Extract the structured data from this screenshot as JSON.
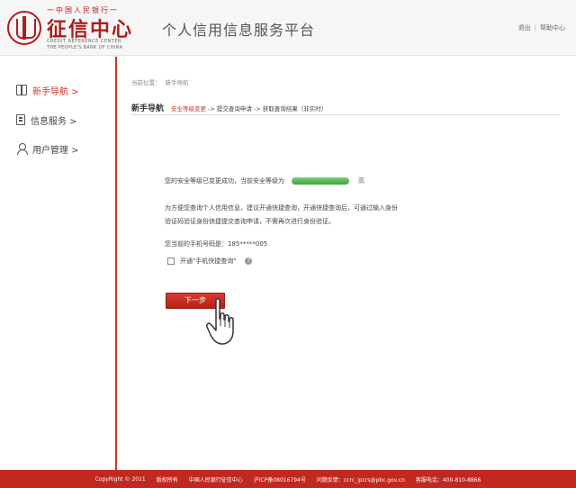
{
  "header": {
    "logo": {
      "top_text": "一中国人民银行一",
      "main_text": "征信中心",
      "en_line1": "CREDIT REFERENCE CENTER",
      "en_line2": "THE PEOPLE'S BANK OF CHINA"
    },
    "site_title": "个人信用信息服务平台",
    "logout_label": "退出",
    "separator": "|",
    "help_label": "帮助中心"
  },
  "sidebar": {
    "items": [
      {
        "label": "新手导航 >",
        "icon": "book-icon",
        "active": true
      },
      {
        "label": "信息服务 >",
        "icon": "document-icon",
        "active": false
      },
      {
        "label": "用户管理 >",
        "icon": "user-icon",
        "active": false
      }
    ]
  },
  "breadcrumb": {
    "prefix": "当前位置：",
    "current": "新手导航"
  },
  "steps": {
    "title": "新手导航",
    "current": "安全等级变更",
    "rest": "-> 提交查询申请 -> 获取查询结果（非实时）"
  },
  "content": {
    "security_message": "您的安全等级已变更成功，当前安全等级为",
    "security_level_word": "高",
    "security_level_color": "#3aa53a",
    "advice_text": "为方便您查询个人信用信息，建议开通快捷查询，开通快捷查询后，可通过输入身份验证码验证身份快捷提交查询申请，不需再次进行身份验证。",
    "phone_text": "您当前的手机号码是：185*****005",
    "checkbox_label": "开通\"手机快捷查询\"",
    "help_icon": "?",
    "next_button_label": "下一步"
  },
  "footer": {
    "copyright": "CopyRight © 2011",
    "rights": "版权所有",
    "org": "中国人民银行征信中心",
    "icp": "沪ICP备08016794号",
    "feedback": "问题反馈：ccrc_ipcrs@pbc.gov.cn",
    "hotline": "客服电话：400-810-8866"
  },
  "colors": {
    "brand_red": "#c0392b",
    "footer_red": "#c2281f"
  }
}
